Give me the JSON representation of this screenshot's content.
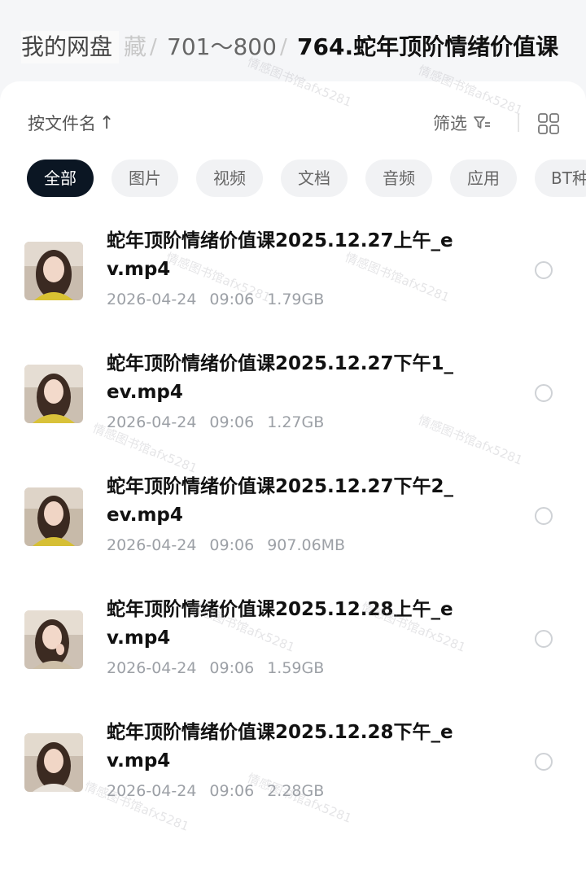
{
  "breadcrumb": {
    "root": "我的网盘",
    "hidden": "藏",
    "sep": "/",
    "middle": "701～800",
    "current": "764.蛇年顶阶情绪价值课"
  },
  "toolbar": {
    "sort_label": "按文件名",
    "sort_arrow": "↑",
    "filter_label": "筛选"
  },
  "chips": [
    "全部",
    "图片",
    "视频",
    "文档",
    "音频",
    "应用",
    "BT种"
  ],
  "files": [
    {
      "name": "蛇年顶阶情绪价值课2025.12.27上午_ev.mp4",
      "date": "2026-04-24",
      "time": "09:06",
      "size": "1.79GB"
    },
    {
      "name": "蛇年顶阶情绪价值课2025.12.27下午1_ev.mp4",
      "date": "2026-04-24",
      "time": "09:06",
      "size": "1.27GB"
    },
    {
      "name": "蛇年顶阶情绪价值课2025.12.27下午2_ev.mp4",
      "date": "2026-04-24",
      "time": "09:06",
      "size": "907.06MB"
    },
    {
      "name": "蛇年顶阶情绪价值课2025.12.28上午_ev.mp4",
      "date": "2026-04-24",
      "time": "09:06",
      "size": "1.59GB"
    },
    {
      "name": "蛇年顶阶情绪价值课2025.12.28下午_ev.mp4",
      "date": "2026-04-24",
      "time": "09:06",
      "size": "2.28GB"
    }
  ],
  "watermark": "情感图书馆afx5281",
  "colors": {
    "active_chip": "#0b1623",
    "chip_bg": "#f1f2f4",
    "meta_text": "#9ca0a6"
  }
}
